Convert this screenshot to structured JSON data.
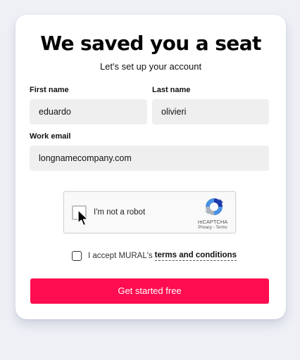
{
  "header": {
    "title": "We saved you a seat",
    "subtitle": "Let's set up your account"
  },
  "form": {
    "first_name": {
      "label": "First name",
      "value": "eduardo"
    },
    "last_name": {
      "label": "Last name",
      "value": "olivieri"
    },
    "work_email": {
      "label": "Work email",
      "value": "longnamecompany.com"
    }
  },
  "recaptcha": {
    "checkbox_label": "I'm not a robot",
    "brand": "reCAPTCHA",
    "privacy_link": "Privacy",
    "separator": " - ",
    "terms_link": "Terms",
    "logo_icon": "recaptcha-logo-icon",
    "checked": false
  },
  "terms": {
    "text": "I accept MURAL's",
    "link": "terms and conditions",
    "checked": false
  },
  "cta": {
    "label": "Get started free",
    "color": "#ff0d50"
  },
  "colors": {
    "background": "#eef0f6",
    "card": "#ffffff",
    "field": "#efefef"
  }
}
